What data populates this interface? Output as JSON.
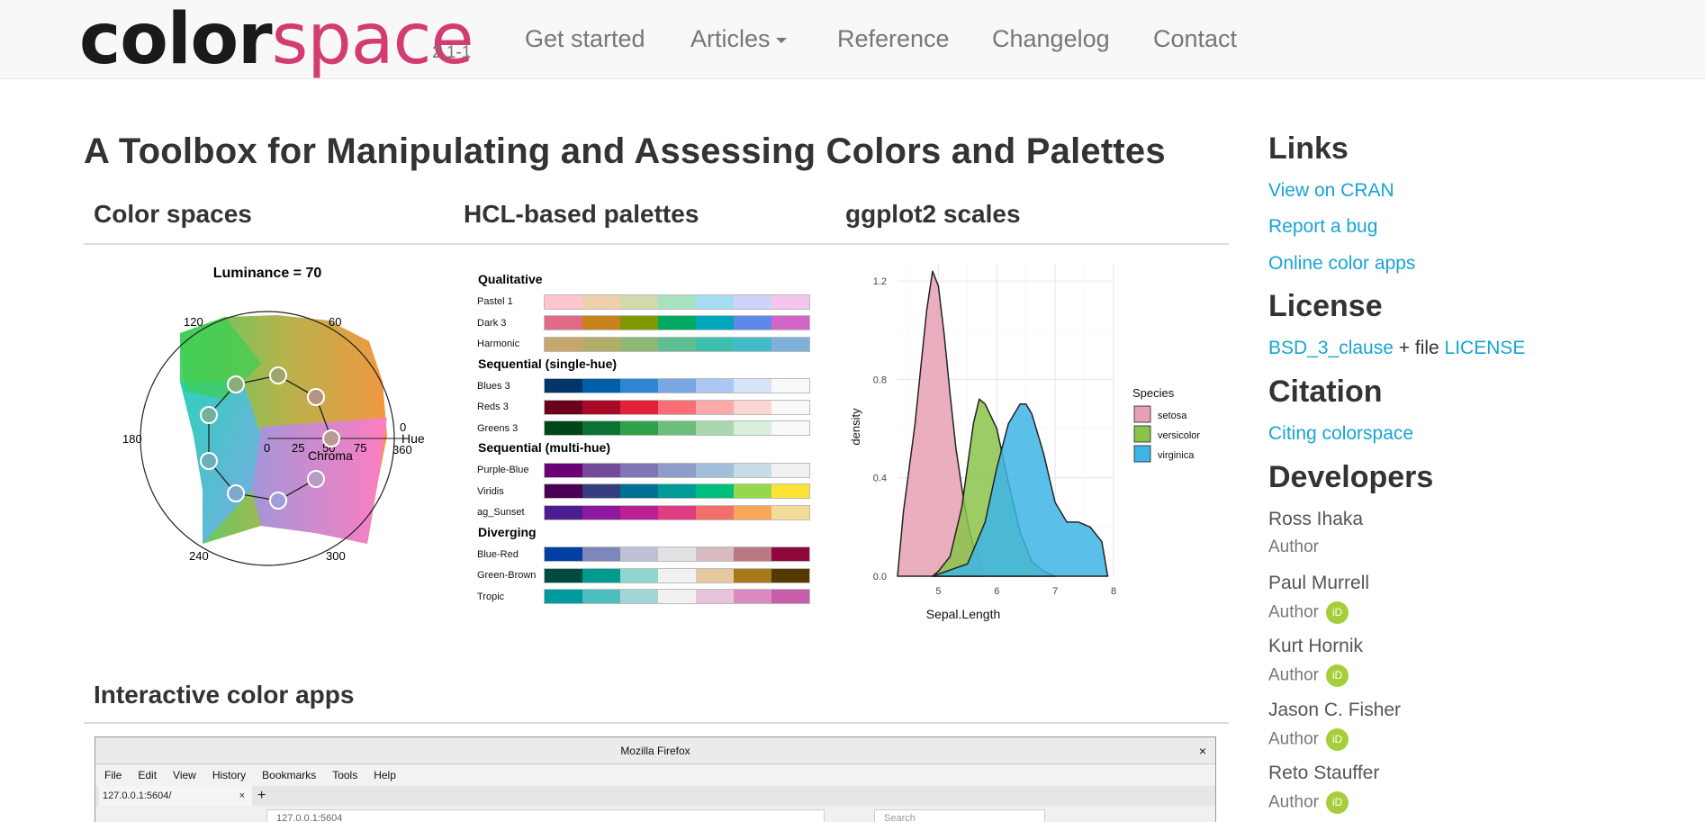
{
  "navbar": {
    "logo_part1": "color",
    "logo_part2": "space",
    "version": "2.1-1",
    "links": [
      "Get started",
      "Articles",
      "Reference",
      "Changelog",
      "Contact"
    ]
  },
  "main": {
    "title": "A Toolbox for Manipulating and Assessing Colors and Palettes",
    "sections": [
      "Color spaces",
      "HCL-based palettes",
      "ggplot2 scales",
      "Interactive color apps"
    ]
  },
  "colorspace_fig": {
    "title": "Luminance = 70",
    "hue_ticks": [
      "120",
      "60",
      "0",
      "360",
      "180",
      "240",
      "300"
    ],
    "chroma_ticks": [
      "0",
      "25",
      "50",
      "75"
    ],
    "hue_label": "Hue",
    "chroma_label": "Chroma"
  },
  "palettes_fig": {
    "groups": [
      {
        "name": "Qualitative",
        "palettes": [
          {
            "label": "Pastel 1",
            "colors": [
              "#FFC5D0",
              "#EFD0AB",
              "#CFDBAB",
              "#A8E1BF",
              "#A4DDEF",
              "#CFD3FA",
              "#F4C6EE"
            ]
          },
          {
            "label": "Dark 3",
            "colors": [
              "#E16A86",
              "#C7821C",
              "#7E9A00",
              "#00A861",
              "#00A6B9",
              "#5D89E8",
              "#D365C8"
            ]
          },
          {
            "label": "Harmonic",
            "colors": [
              "#C7A76C",
              "#B0AE67",
              "#8FB875",
              "#5DBE91",
              "#3DBFAD",
              "#43BDC5",
              "#7EB0D9"
            ]
          }
        ]
      },
      {
        "name": "Sequential (single-hue)",
        "palettes": [
          {
            "label": "Blues 3",
            "colors": [
              "#00366C",
              "#005FAA",
              "#2F86D4",
              "#78A7E3",
              "#A9C7F2",
              "#D6E4FA",
              "#F9F9F9"
            ]
          },
          {
            "label": "Reds 3",
            "colors": [
              "#6A001C",
              "#A70A27",
              "#E2203A",
              "#FA6E75",
              "#FBA9A9",
              "#FCD5D5",
              "#F9F9F9"
            ]
          },
          {
            "label": "Greens 3",
            "colors": [
              "#004616",
              "#0C7333",
              "#2FA148",
              "#6DBD7D",
              "#A9D7AF",
              "#D8EDDA",
              "#F9F9F9"
            ]
          }
        ]
      },
      {
        "name": "Sequential (multi-hue)",
        "palettes": [
          {
            "label": "Purple-Blue",
            "colors": [
              "#6B0077",
              "#744B9A",
              "#8174B2",
              "#8D9CC8",
              "#A3BFDA",
              "#C7DCE7",
              "#F1F1F1"
            ]
          },
          {
            "label": "Viridis",
            "colors": [
              "#4B0055",
              "#353E7C",
              "#007094",
              "#009B95",
              "#00BE7D",
              "#96D84B",
              "#FDE333"
            ]
          },
          {
            "label": "ag_Sunset",
            "colors": [
              "#4B1D91",
              "#8C1A9E",
              "#BC1E94",
              "#DF3C81",
              "#F26F6A",
              "#F7A75B",
              "#F3DB99"
            ]
          }
        ]
      },
      {
        "name": "Diverging",
        "palettes": [
          {
            "label": "Blue-Red",
            "colors": [
              "#023FA5",
              "#7D87B9",
              "#BEC1D4",
              "#E2E2E2",
              "#D6BCC0",
              "#BB7784",
              "#8E063B"
            ]
          },
          {
            "label": "Green-Brown",
            "colors": [
              "#004B40",
              "#009B8E",
              "#8ED7CE",
              "#F1F1F1",
              "#E2C9A0",
              "#A6781C",
              "#543A00"
            ]
          },
          {
            "label": "Tropic",
            "colors": [
              "#009B9F",
              "#4CBEBE",
              "#A3D6D4",
              "#F1F1F1",
              "#E7C3DC",
              "#DC8BC0",
              "#C75DAB"
            ]
          }
        ]
      }
    ]
  },
  "chart_data": {
    "type": "area",
    "xlabel": "Sepal.Length",
    "ylabel": "density",
    "xlim": [
      4.3,
      8.0
    ],
    "ylim": [
      0,
      1.27
    ],
    "x_ticks": [
      5,
      6,
      7,
      8
    ],
    "y_ticks": [
      0.0,
      0.4,
      0.8,
      1.2
    ],
    "legend_title": "Species",
    "legend_position": "right",
    "grid": true,
    "series": [
      {
        "name": "setosa",
        "color": "#E8A0B4",
        "stroke": "#222222",
        "x": [
          4.3,
          4.4,
          4.5,
          4.6,
          4.7,
          4.8,
          4.9,
          5.0,
          5.1,
          5.2,
          5.3,
          5.4,
          5.5,
          5.6,
          5.7,
          5.8
        ],
        "y": [
          0.0,
          0.26,
          0.44,
          0.62,
          0.85,
          1.08,
          1.24,
          1.18,
          0.98,
          0.74,
          0.52,
          0.36,
          0.22,
          0.12,
          0.05,
          0.0
        ]
      },
      {
        "name": "versicolor",
        "color": "#8BC34A",
        "stroke": "#222222",
        "x": [
          4.9,
          5.0,
          5.2,
          5.4,
          5.6,
          5.7,
          5.8,
          6.0,
          6.2,
          6.4,
          6.6,
          6.8,
          7.0
        ],
        "y": [
          0.0,
          0.02,
          0.08,
          0.28,
          0.62,
          0.72,
          0.7,
          0.6,
          0.38,
          0.18,
          0.06,
          0.02,
          0.0
        ]
      },
      {
        "name": "virginica",
        "color": "#3DB5E6",
        "stroke": "#222222",
        "x": [
          4.9,
          5.5,
          5.8,
          6.0,
          6.2,
          6.4,
          6.5,
          6.6,
          6.8,
          7.0,
          7.2,
          7.4,
          7.6,
          7.8,
          7.9
        ],
        "y": [
          0.0,
          0.05,
          0.22,
          0.44,
          0.62,
          0.7,
          0.7,
          0.66,
          0.5,
          0.3,
          0.22,
          0.22,
          0.2,
          0.14,
          0.0
        ]
      }
    ]
  },
  "sidebar": {
    "links_heading": "Links",
    "links": [
      "View on CRAN",
      "Report a bug",
      "Online color apps"
    ],
    "license_heading": "License",
    "license_link1": "BSD_3_clause",
    "license_text": " + file ",
    "license_link2": "LICENSE",
    "citation_heading": "Citation",
    "citation_link": "Citing colorspace",
    "developers_heading": "Developers",
    "developers": [
      {
        "name": "Ross Ihaka",
        "role": "Author",
        "orcid": false
      },
      {
        "name": "Paul Murrell",
        "role": "Author",
        "orcid": true
      },
      {
        "name": "Kurt Hornik",
        "role": "Author",
        "orcid": true
      },
      {
        "name": "Jason C. Fisher",
        "role": "Author",
        "orcid": true
      },
      {
        "name": "Reto Stauffer",
        "role": "Author",
        "orcid": true
      }
    ],
    "orcid_label": "iD"
  },
  "firefox": {
    "window_title": "Mozilla Firefox",
    "close": "×",
    "menu": [
      "File",
      "Edit",
      "View",
      "History",
      "Bookmarks",
      "Tools",
      "Help"
    ],
    "tab_label": "127.0.0.1:5604/",
    "tab_close": "×",
    "new_tab": "+",
    "url": "127.0.0.1:5604",
    "search_placeholder": "Search"
  }
}
